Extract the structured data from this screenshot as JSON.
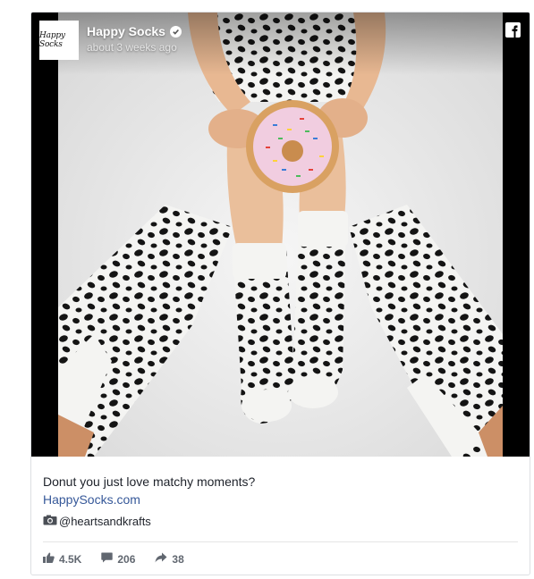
{
  "post": {
    "page_name": "Happy Socks",
    "timestamp": "about 3 weeks ago",
    "logo_text": "Happy Socks",
    "caption": "Donut you just love matchy moments?",
    "link": "HappySocks.com",
    "credit": "@heartsandkrafts"
  },
  "stats": {
    "likes": "4.5K",
    "comments": "206",
    "shares": "38"
  },
  "icons": {
    "verified": "verified-check-icon",
    "network": "facebook-icon",
    "camera": "camera-icon",
    "like": "thumbs-up-icon",
    "comment": "comment-icon",
    "share": "share-arrow-icon"
  },
  "colors": {
    "link": "#365899",
    "text": "#1d2129",
    "muted": "#616770"
  }
}
